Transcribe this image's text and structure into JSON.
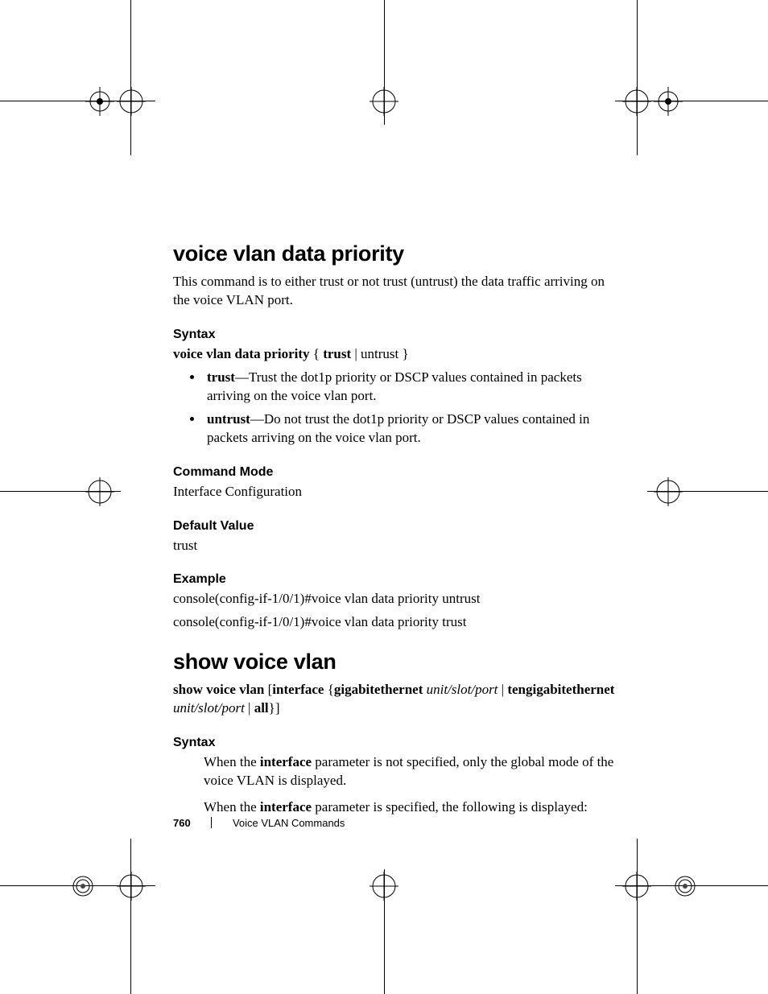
{
  "section1": {
    "title": "voice vlan data priority",
    "intro": "This command is to either trust or not trust (untrust) the data traffic arriving on the voice VLAN port.",
    "syntax_h": "Syntax",
    "syntax_line_pre": "voice vlan data priority",
    "syntax_line_mid": " { ",
    "syntax_line_bold2": "trust",
    "syntax_line_mid2": " | ",
    "syntax_line_tail": "untrust }",
    "bullet1_b": "trust",
    "bullet1_t": "—Trust the dot1p priority or DSCP values contained in packets arriving on the voice vlan port.",
    "bullet2_b": "untrust",
    "bullet2_t": "—Do not trust the dot1p priority or DSCP values contained in packets arriving on the voice vlan port.",
    "cmdmode_h": "Command Mode",
    "cmdmode_t": "Interface Configuration",
    "default_h": "Default Value",
    "default_t": "trust",
    "example_h": "Example",
    "example_l1": "console(config-if-1/0/1)#voice vlan data priority untrust",
    "example_l2": "console(config-if-1/0/1)#voice vlan data priority trust"
  },
  "section2": {
    "title": "show voice vlan",
    "cmd_b1": "show voice vlan",
    "cmd_t1": " [",
    "cmd_b2": "interface",
    "cmd_t2": " {",
    "cmd_b3": "gigabitethernet",
    "cmd_i1": " unit/slot/port",
    "cmd_t3": " | ",
    "cmd_b4": "tengigabitethernet",
    "cmd_i2": " unit/slot/port ",
    "cmd_t4": " | ",
    "cmd_b5": "all",
    "cmd_t5": "}]",
    "syntax_h": "Syntax",
    "p1a": "When the ",
    "p1b": "interface",
    "p1c": " parameter is not specified, only the global mode of the voice VLAN is displayed.",
    "p2a": "When the ",
    "p2b": "interface",
    "p2c": " parameter is specified, the following is displayed:"
  },
  "footer": {
    "page": "760",
    "chapter": "Voice VLAN Commands"
  }
}
